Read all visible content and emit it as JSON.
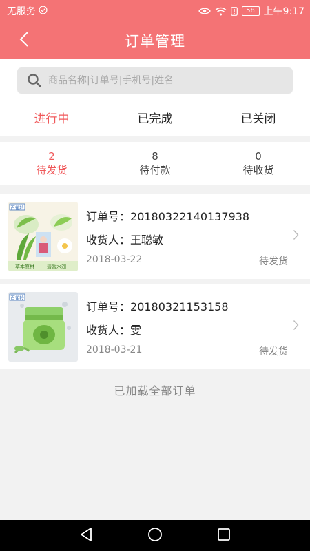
{
  "status_bar": {
    "carrier": "无服务",
    "battery": "58",
    "time": "上午9:17"
  },
  "header": {
    "title": "订单管理",
    "back_icon": "chevron-left-icon"
  },
  "search": {
    "placeholder": "商品名称|订单号|手机号|姓名",
    "icon": "search-icon"
  },
  "tabs": [
    {
      "label": "进行中",
      "active": true
    },
    {
      "label": "已完成",
      "active": false
    },
    {
      "label": "已关闭",
      "active": false
    }
  ],
  "sub_tabs": [
    {
      "count": "2",
      "label": "待发货",
      "active": true
    },
    {
      "count": "8",
      "label": "待付款",
      "active": false
    },
    {
      "count": "0",
      "label": "待收货",
      "active": false
    }
  ],
  "orders": [
    {
      "order_no_label": "订单号：",
      "order_no": "20180322140137938",
      "receiver_label": "收货人：",
      "receiver": "王聪敏",
      "date": "2018-03-22",
      "status": "待发货",
      "image": {
        "brand": "百雀羚",
        "caption_left": "草本原材",
        "caption_right": "清香水润"
      }
    },
    {
      "order_no_label": "订单号：",
      "order_no": "20180321153158",
      "receiver_label": "收货人：",
      "receiver": "雯",
      "date": "2018-03-21",
      "status": "待发货",
      "image": {
        "brand": "百雀羚"
      }
    }
  ],
  "footer": {
    "text": "已加载全部订单"
  },
  "colors": {
    "primary": "#f47375",
    "accent_text": "#f0585a",
    "background": "#f2f2f2"
  }
}
